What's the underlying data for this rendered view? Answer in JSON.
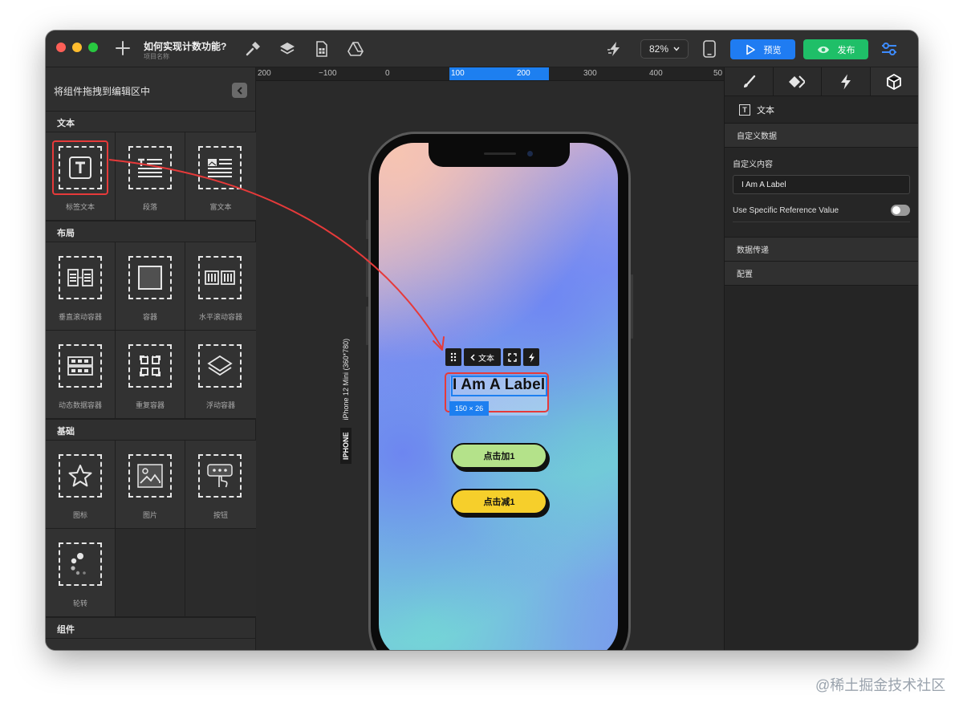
{
  "toolbar": {
    "project_title": "如何实现计数功能?",
    "project_subtitle": "项目名称",
    "zoom": "82%",
    "preview_label": "预览",
    "publish_label": "发布"
  },
  "left_panel": {
    "header": "将组件拖拽到编辑区中",
    "sections": {
      "text": {
        "title": "文本",
        "items": [
          "标签文本",
          "段落",
          "富文本"
        ]
      },
      "layout": {
        "title": "布局",
        "items": [
          "垂直滚动容器",
          "容器",
          "水平滚动容器",
          "动态数据容器",
          "重复容器",
          "浮动容器"
        ]
      },
      "basic": {
        "title": "基础",
        "items": [
          "图标",
          "图片",
          "按钮",
          "轮转"
        ]
      },
      "components": {
        "title": "组件"
      }
    }
  },
  "canvas": {
    "ruler_labels": [
      "200",
      "−100",
      "0",
      "100",
      "200",
      "300",
      "400",
      "50"
    ],
    "device_tag": "IPHONE",
    "device_name": "iPhone 12 Mini (360*780)",
    "label_toolbar": {
      "back_text": "文本"
    },
    "label_text": "I Am A Label",
    "size_badge": "150 × 26",
    "button_add": "点击加1",
    "button_sub": "点击减1"
  },
  "right_panel": {
    "component_title": "文本",
    "section_custom_data": "自定义数据",
    "field_label": "自定义内容",
    "field_value": "I Am A Label",
    "toggle_label": "Use Specific Reference Value",
    "toggle_on": false,
    "section_data_transfer": "数据传递",
    "section_config": "配置"
  },
  "watermark": "@稀土掘金技术社区",
  "colors": {
    "accent_blue": "#1f7cf2",
    "publish_green": "#1fbf68",
    "highlight_red": "#e63a3a",
    "button_add_bg": "#b4e28a",
    "button_sub_bg": "#f6cf2b"
  }
}
